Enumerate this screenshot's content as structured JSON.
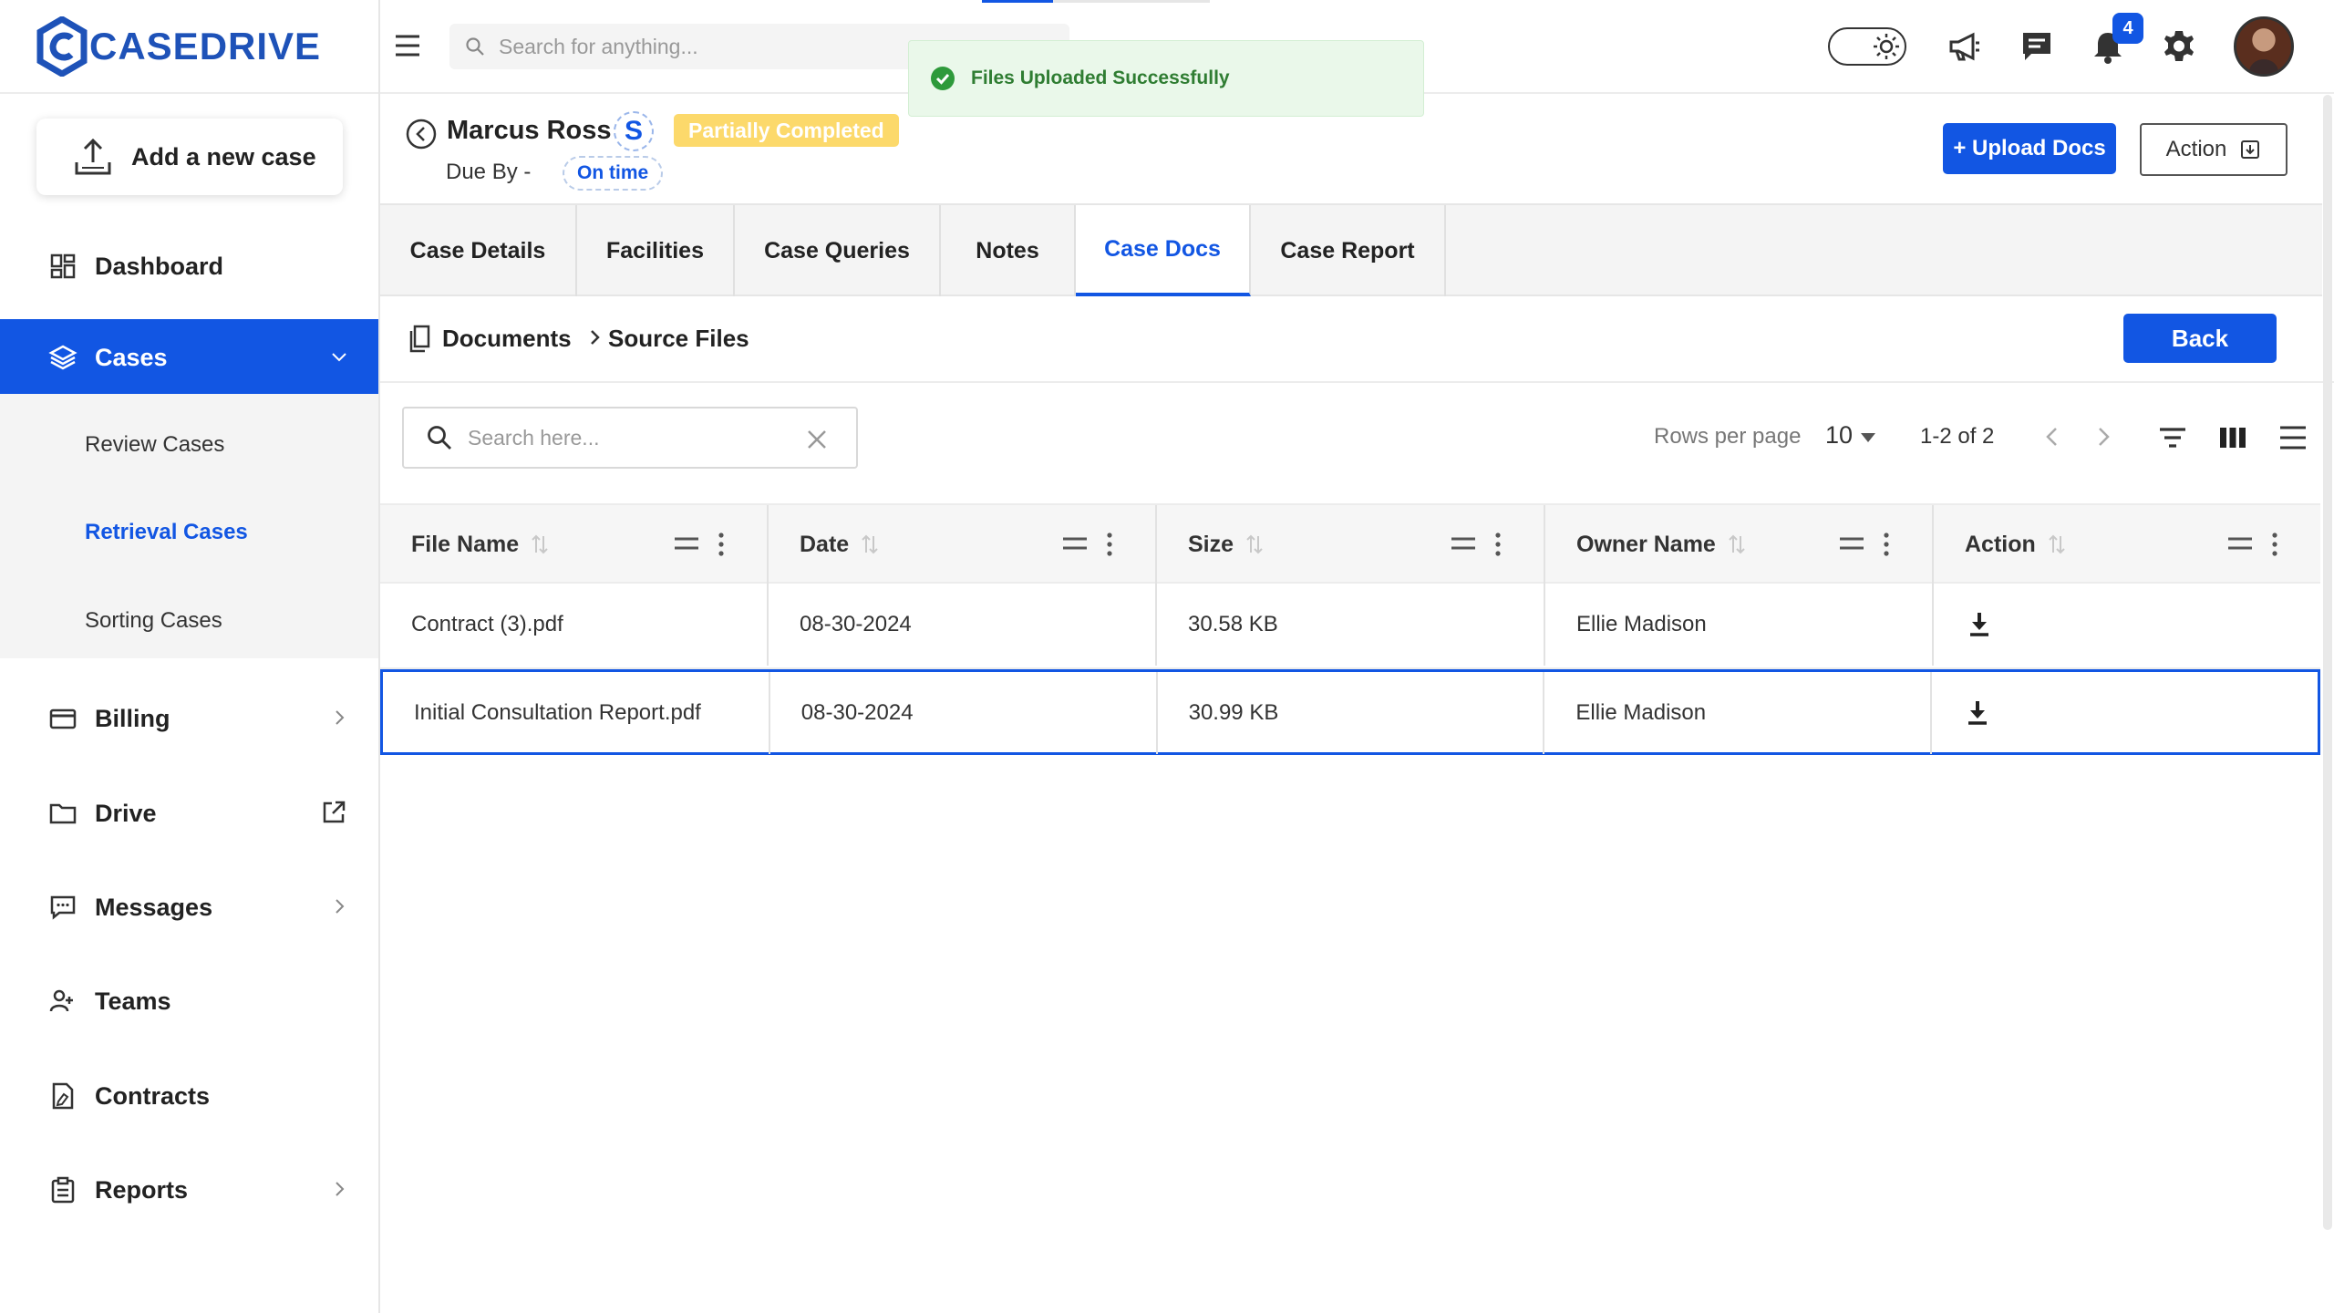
{
  "brand": {
    "name": "CASEDRIVE",
    "color": "#1e52b8"
  },
  "colors": {
    "primary": "#1256e3",
    "status_partial": "#fcd96b",
    "toast_bg": "#eaf8ea",
    "toast_text": "#2f7d32"
  },
  "sidebar": {
    "add_case_label": "Add a new case",
    "items": [
      {
        "label": "Dashboard",
        "icon": "dashboard-icon"
      },
      {
        "label": "Cases",
        "icon": "layers-icon",
        "expanded": true
      },
      {
        "label": "Billing",
        "icon": "card-icon"
      },
      {
        "label": "Drive",
        "icon": "folder-icon"
      },
      {
        "label": "Messages",
        "icon": "message-icon"
      },
      {
        "label": "Teams",
        "icon": "users-icon"
      },
      {
        "label": "Contracts",
        "icon": "contract-icon"
      },
      {
        "label": "Reports",
        "icon": "clipboard-icon"
      }
    ],
    "sub_items": [
      "Review Cases",
      "Retrieval Cases",
      "Sorting Cases"
    ],
    "active_sub": "Retrieval Cases"
  },
  "topbar": {
    "search_placeholder": "Search for anything...",
    "notification_count": "4"
  },
  "toast": {
    "message": "Files Uploaded Successfully"
  },
  "case": {
    "name": "Marcus Ross",
    "initial": "S",
    "status": "Partially Completed",
    "due_by_label": "Due By -",
    "due_status": "On time",
    "upload_label": "+ Upload Docs",
    "action_label": "Action"
  },
  "tabs": [
    "Case Details",
    "Facilities",
    "Case Queries",
    "Notes",
    "Case Docs",
    "Case Report"
  ],
  "active_tab": "Case Docs",
  "breadcrumb": {
    "root": "Documents",
    "current": "Source Files",
    "back_label": "Back"
  },
  "table_toolbar": {
    "search_placeholder": "Search here...",
    "rows_per_page_label": "Rows per page",
    "rows_per_page": "10",
    "range": "1-2 of 2"
  },
  "table": {
    "columns": [
      "File Name",
      "Date",
      "Size",
      "Owner Name",
      "Action"
    ],
    "rows": [
      {
        "file_name": "Contract (3).pdf",
        "date": "08-30-2024",
        "size": "30.58 KB",
        "owner": "Ellie Madison"
      },
      {
        "file_name": "Initial Consultation Report.pdf",
        "date": "08-30-2024",
        "size": "30.99 KB",
        "owner": "Ellie Madison",
        "selected": true
      }
    ]
  }
}
